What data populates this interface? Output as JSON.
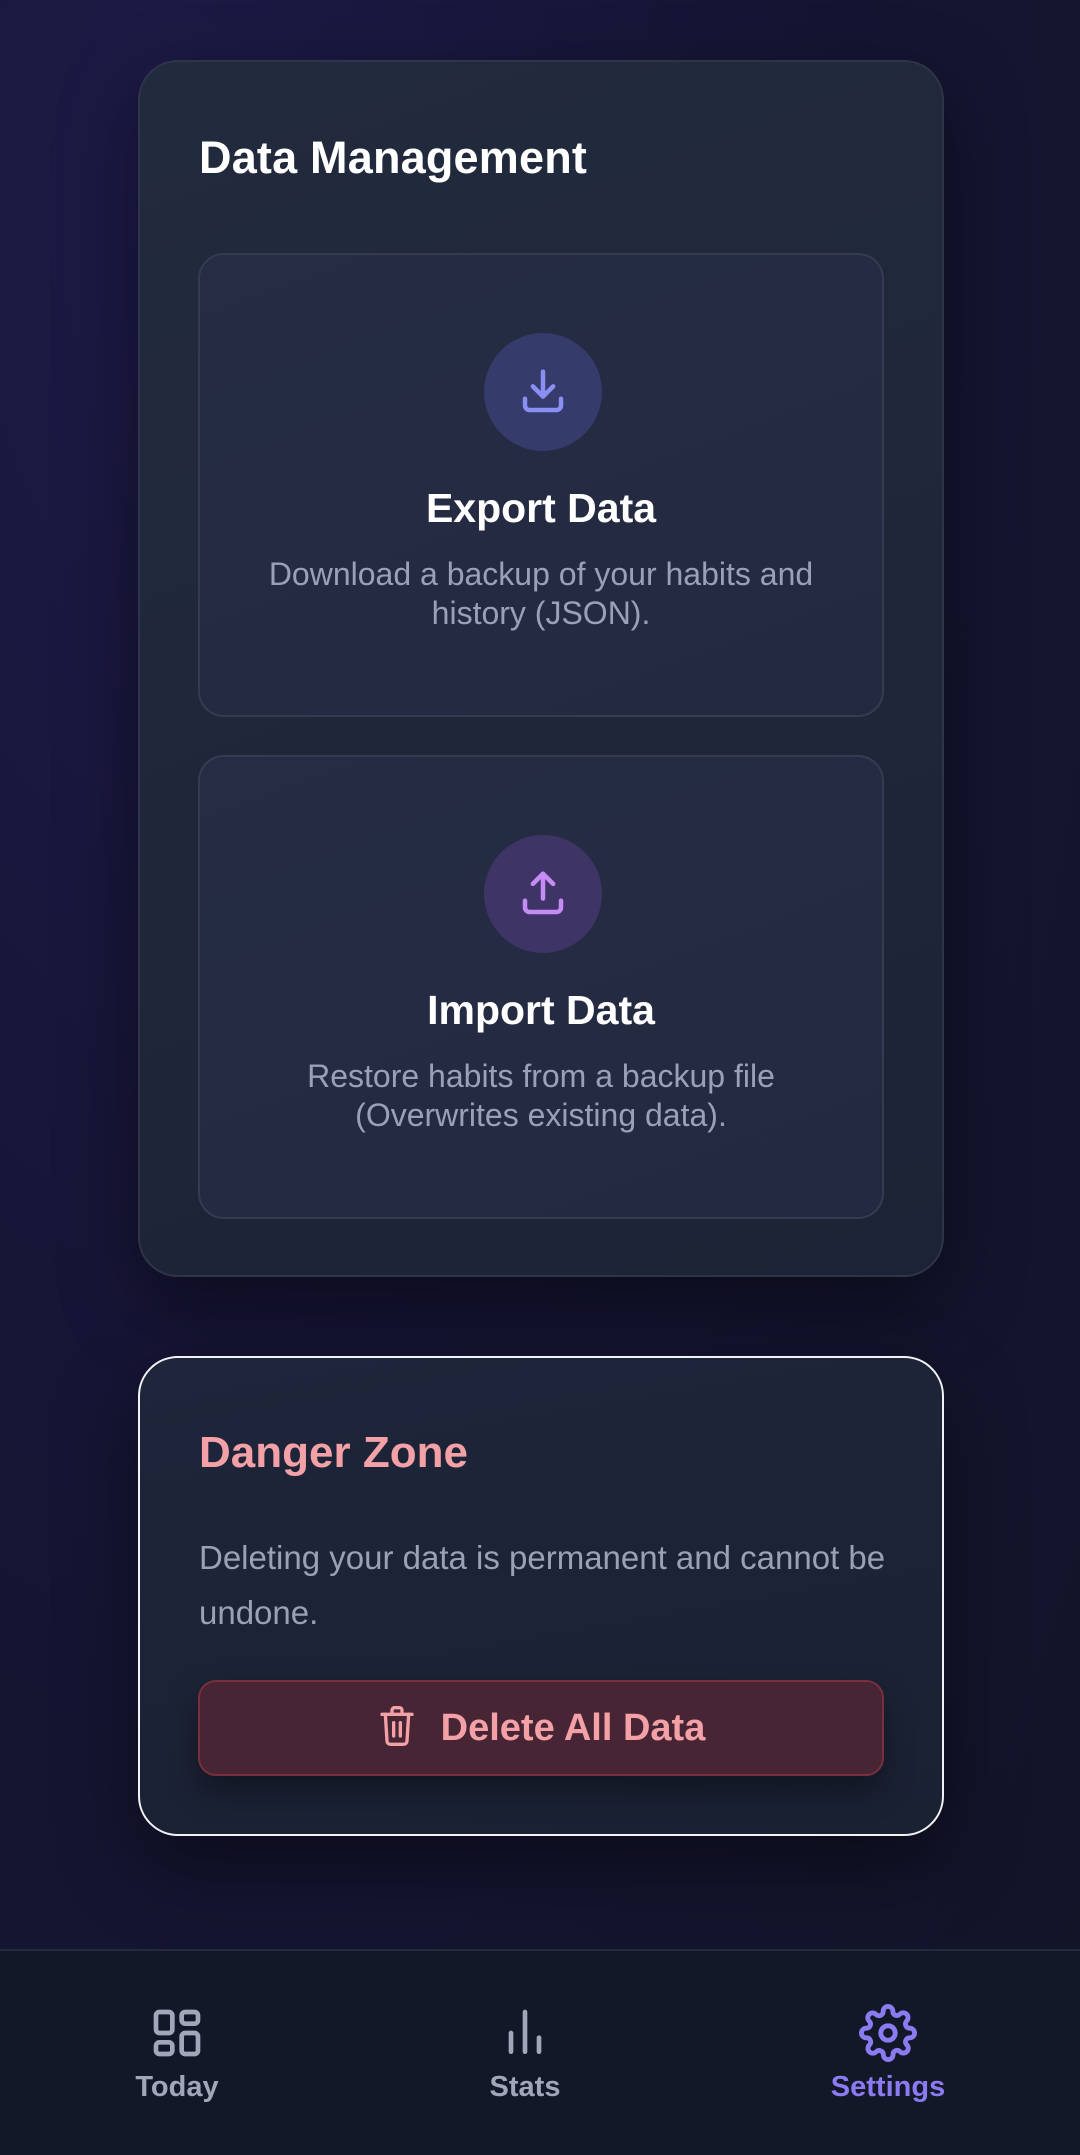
{
  "data_management": {
    "title": "Data Management",
    "export": {
      "title": "Export Data",
      "description": "Download a backup of your habits and history (JSON).",
      "icon": "download-icon"
    },
    "import": {
      "title": "Import Data",
      "description": "Restore habits from a backup file (Overwrites existing data).",
      "icon": "upload-icon"
    }
  },
  "danger_zone": {
    "title": "Danger Zone",
    "description": "Deleting your data is permanent and cannot be undone.",
    "delete_button_label": "Delete All Data",
    "delete_icon": "trash-icon"
  },
  "bottom_nav": {
    "items": [
      {
        "label": "Today",
        "icon": "grid-icon",
        "active": false
      },
      {
        "label": "Stats",
        "icon": "bar-chart-icon",
        "active": false
      },
      {
        "label": "Settings",
        "icon": "gear-icon",
        "active": true
      }
    ]
  },
  "colors": {
    "accent": "#8b7bf2",
    "danger_text": "#f3a0a6",
    "danger_bg": "#482535",
    "export_icon": "#8b8ff4",
    "import_icon": "#c68bf4"
  }
}
